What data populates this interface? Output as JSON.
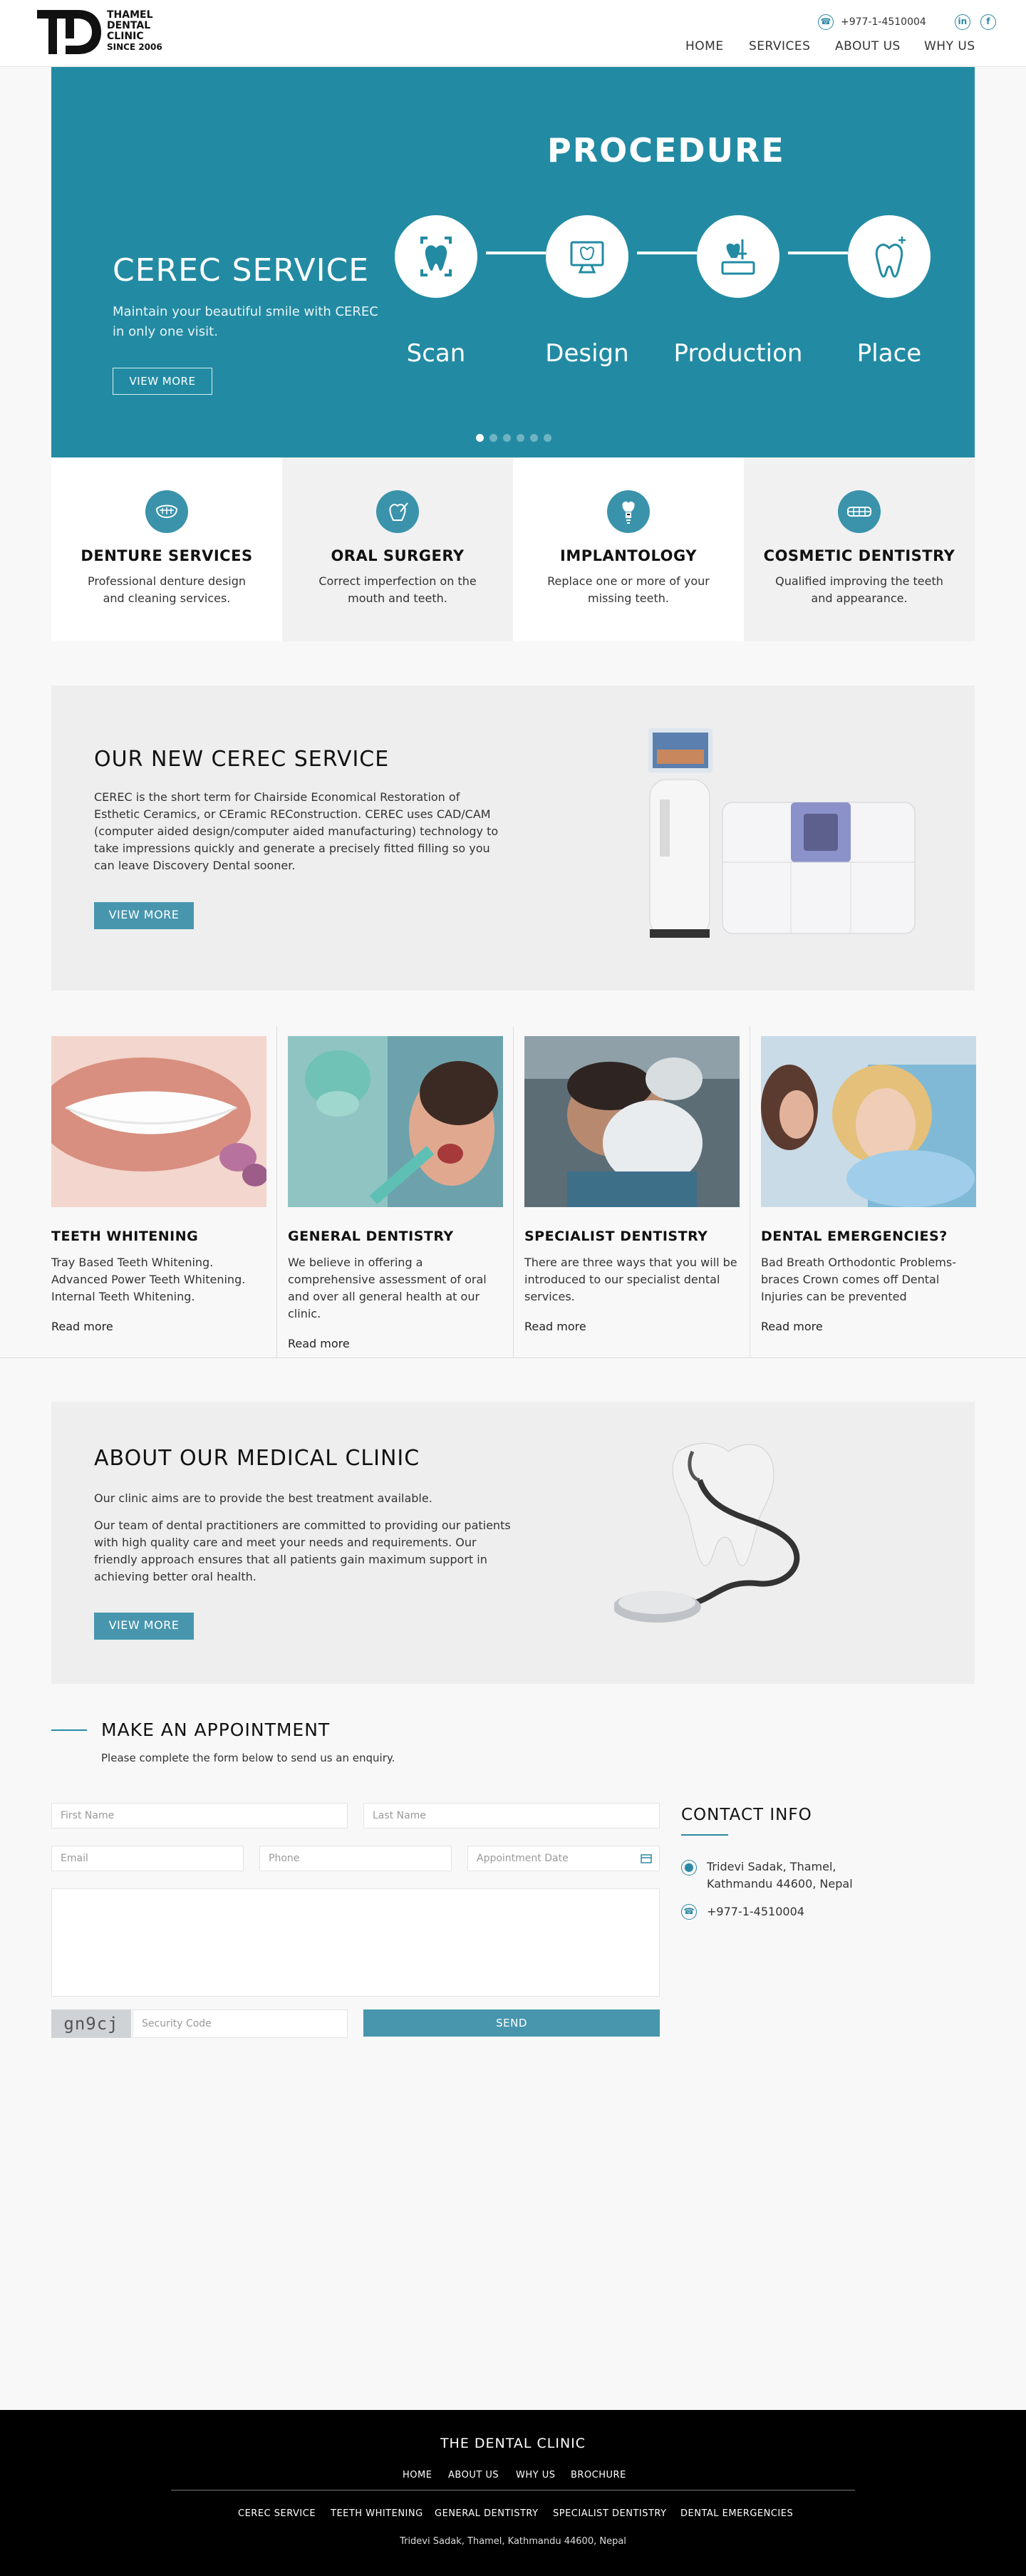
{
  "brand": {
    "line1": "THAMEL",
    "line2": "DENTAL",
    "line3": "CLINIC",
    "since": "SINCE 2006"
  },
  "topbar": {
    "phone": "+977-1-4510004",
    "linkedin_icon": "in",
    "facebook_icon": "f"
  },
  "nav": [
    "HOME",
    "SERVICES",
    "ABOUT US",
    "WHY US"
  ],
  "hero": {
    "title": "CEREC SERVICE",
    "subtitle": "Maintain your beautiful smile with CEREC in only one visit.",
    "button": "VIEW MORE",
    "procedure_title": "PROCEDURE",
    "steps": [
      "Scan",
      "Design",
      "Production",
      "Place"
    ],
    "slide_count": 6,
    "active_slide": 1
  },
  "services": [
    {
      "title": "DENTURE SERVICES",
      "text": "Professional denture design and cleaning services."
    },
    {
      "title": "ORAL SURGERY",
      "text": "Correct imperfection on the mouth and teeth."
    },
    {
      "title": "IMPLANTOLOGY",
      "text": "Replace one or more of your missing teeth."
    },
    {
      "title": "COSMETIC DENTISTRY",
      "text": "Qualified improving the teeth and appearance."
    }
  ],
  "cerec": {
    "title": "OUR NEW CEREC SERVICE",
    "text": "CEREC is the short term for Chairside Economical Restoration of Esthetic Ceramics, or CEramic REConstruction. CEREC uses CAD/CAM (computer aided design/computer aided manufacturing) technology to take impressions quickly and generate a precisely fitted filling so you can leave Discovery Dental sooner.",
    "button": "VIEW MORE"
  },
  "cards": [
    {
      "title": "TEETH WHITENING",
      "text": "Tray Based Teeth Whitening. Advanced Power Teeth Whitening. Internal Teeth Whitening.",
      "link": "Read more"
    },
    {
      "title": "GENERAL DENTISTRY",
      "text": "We believe in offering a comprehensive assessment of oral and over all general health at our clinic.",
      "link": "Read more"
    },
    {
      "title": "SPECIALIST DENTISTRY",
      "text": "There are three ways that you will be introduced to our specialist dental services.",
      "link": "Read more"
    },
    {
      "title": "DENTAL EMERGENCIES?",
      "text": "Bad Breath Orthodontic Problems- braces Crown comes off Dental Injuries can be prevented",
      "link": "Read more"
    }
  ],
  "about": {
    "title": "ABOUT OUR MEDICAL CLINIC",
    "p1": "Our clinic aims are to provide the best treatment available.",
    "p2": "Our team of dental practitioners are committed to providing our patients with high quality care and meet your needs and requirements. Our friendly approach ensures that all patients gain maximum support in achieving better oral health.",
    "button": "VIEW MORE"
  },
  "appointment": {
    "title": "MAKE AN APPOINTMENT",
    "subtitle": "Please complete the form below to send us an enquiry.",
    "first_name": "First Name",
    "last_name": "Last Name",
    "email": "Email",
    "phone": "Phone",
    "date": "Appointment Date",
    "captcha": "gn9cj",
    "security": "Security Code",
    "send": "SEND"
  },
  "contact": {
    "title": "CONTACT INFO",
    "address_line1": "Tridevi Sadak, Thamel,",
    "address_line2": "Kathmandu 44600, Nepal",
    "phone": "+977-1-4510004"
  },
  "footer": {
    "title": "THE DENTAL CLINIC",
    "links": [
      "HOME",
      "ABOUT US",
      "WHY US",
      "BROCHURE"
    ],
    "services": [
      "CEREC SERVICE",
      "TEETH WHITENING",
      "GENERAL DENTISTRY",
      "SPECIALIST DENTISTRY",
      "DENTAL EMERGENCIES"
    ],
    "address": "Tridevi Sadak, Thamel, Kathmandu 44600, Nepal"
  },
  "colors": {
    "accent": "#228ba3",
    "button": "#4796ae",
    "footer": "#000000"
  }
}
